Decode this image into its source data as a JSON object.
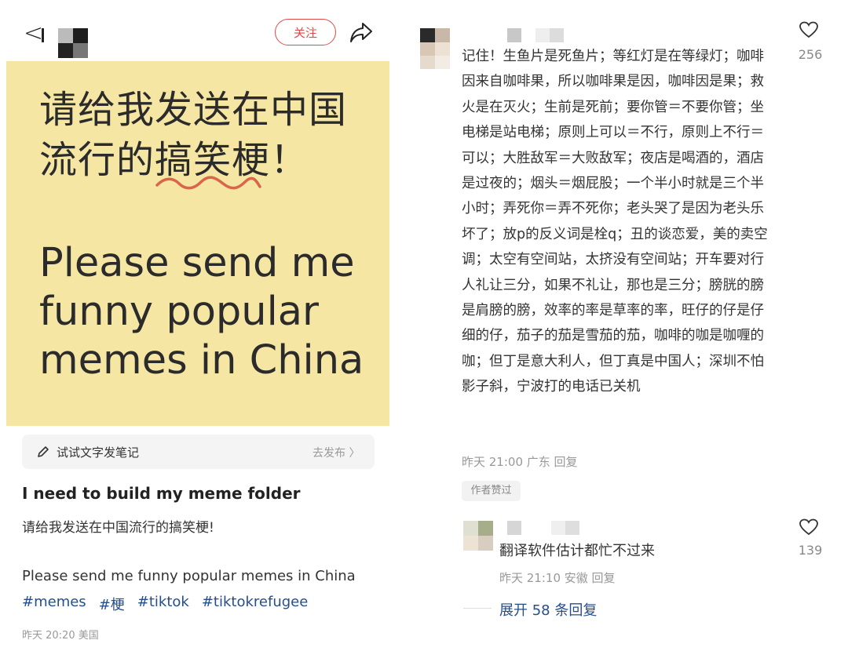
{
  "left": {
    "follow_label": "关注",
    "post_image": {
      "zh_text": "请给我发送在中国流行的搞笑梗！",
      "en_text": "Please send me funny popular memes in China"
    },
    "try_bar": {
      "label": "试试文字发笔记",
      "action": "去发布 〉"
    },
    "post": {
      "title": "I need to build my meme folder",
      "body_zh": "请给我发送在中国流行的搞笑梗!",
      "body_en": "Please send me funny popular memes in China",
      "tags": [
        "#memes",
        "#梗",
        "#tiktok",
        "#tiktokrefugee"
      ],
      "meta": "昨天 20:20 美国"
    },
    "icons": {
      "back": "back-chevron-icon",
      "share": "share-arrow-icon",
      "edit": "pencil-icon"
    }
  },
  "comments": [
    {
      "text": "记住！生鱼片是死鱼片；等红灯是在等绿灯；咖啡因来自咖啡果，所以咖啡果是因，咖啡因是果；救火是在灭火；生前是死前；要你管＝不要你管；坐电梯是站电梯；原则上可以＝不行，原则上不行＝可以；大胜敌军＝大败敌军；夜店是喝酒的，酒店是过夜的；烟头＝烟屁股；一个半小时就是三个半小时；弄死你＝弄不死你；老头哭了是因为老头乐坏了；放p的反义词是栓q；丑的谈恋爱，美的卖空调；太空有空间站，太挤没有空间站；开车要对行人礼让三分，如果不礼让，那也是三分；膀胱的膀是肩膀的膀，效率的率是草率的率，旺仔的仔是仔细的仔，茄子的茄是雪茄的茄，咖啡的咖是咖喱的咖；但丁是意大利人，但丁真是中国人；深圳不怕影子斜，宁波打的电话已关机",
      "meta": "昨天 21:00 广东 回复",
      "badge": "作者赞过",
      "likes": "256"
    },
    {
      "text": "翻译软件估计都忙不过来",
      "meta": "昨天 21:10 安徽 回复",
      "likes": "139"
    }
  ],
  "expand_label": "展开 58 条回复",
  "colors": {
    "accent_red": "#e04a4a",
    "image_bg": "#f5e6a4",
    "link_blue": "#264d8c",
    "squiggle": "#d9664a"
  }
}
